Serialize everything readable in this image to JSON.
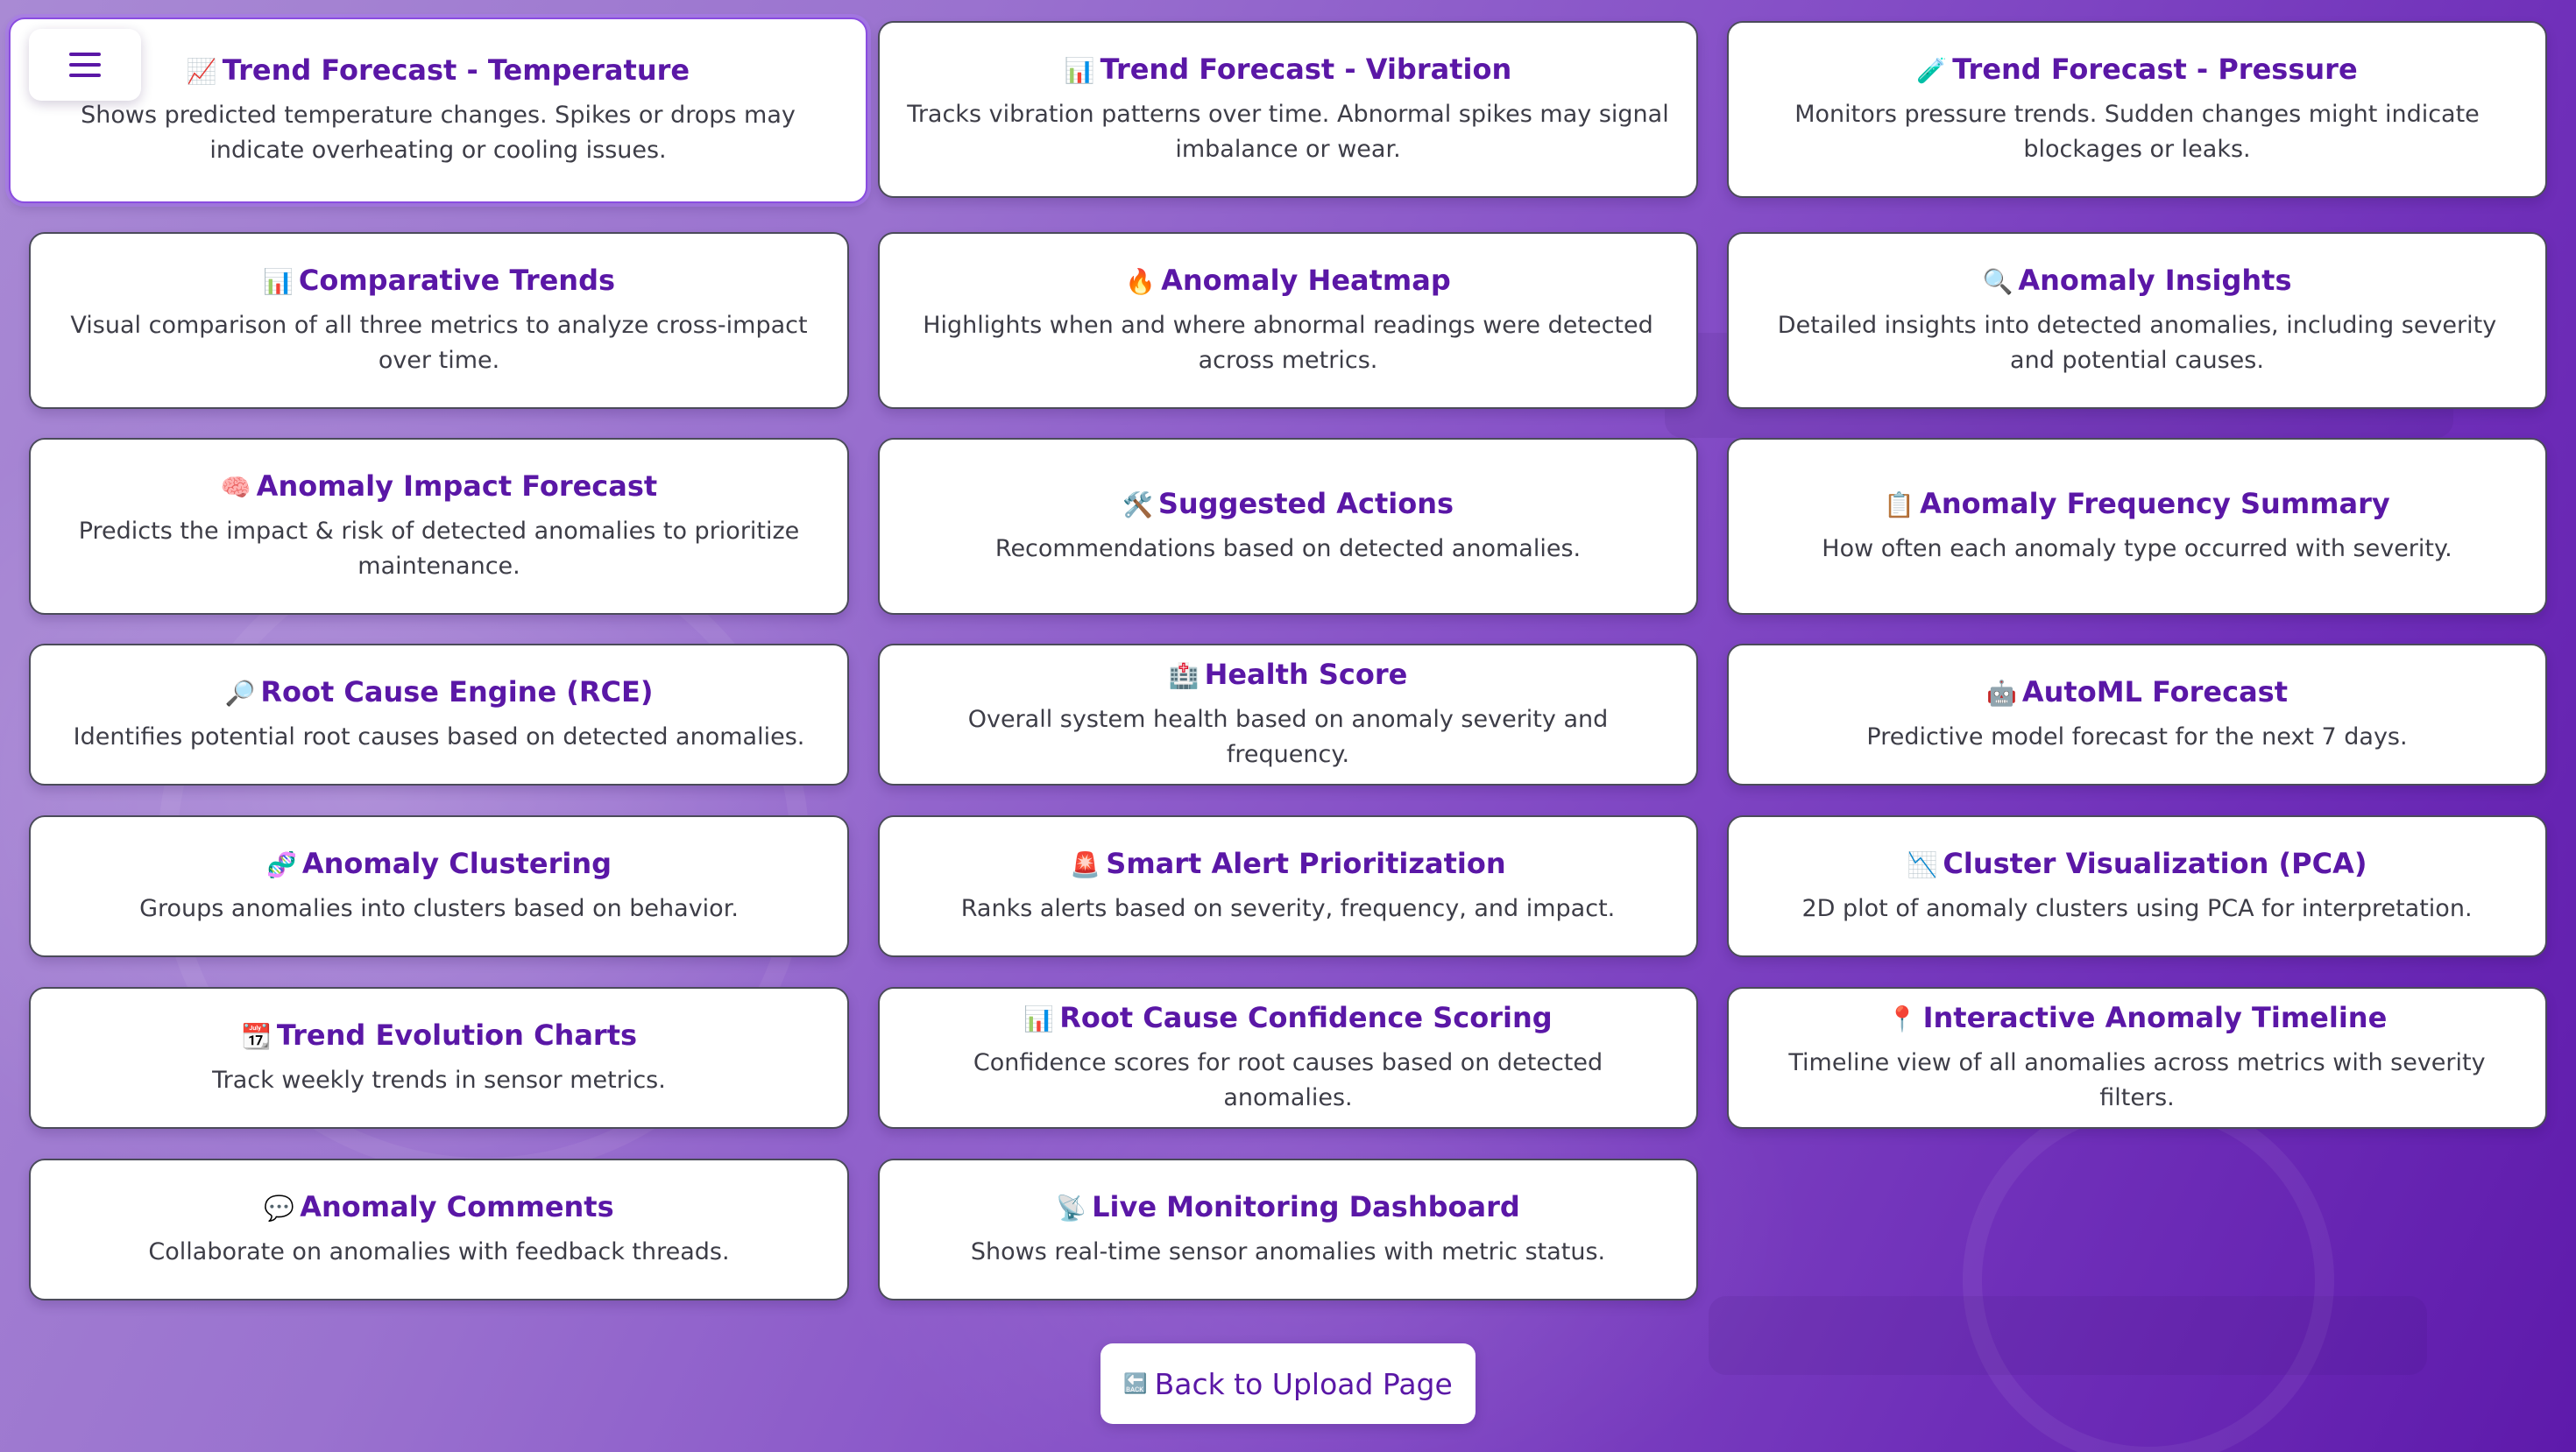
{
  "menu": {
    "icon": "hamburger-menu-icon"
  },
  "cards": [
    {
      "emoji": "📈",
      "icon": "chart-increasing-icon",
      "title": "Trend Forecast - Temperature",
      "desc": "Shows predicted temperature changes. Spikes or drops may indicate overheating or cooling issues."
    },
    {
      "emoji": "📊",
      "icon": "bar-chart-icon",
      "title": "Trend Forecast - Vibration",
      "desc": "Tracks vibration patterns over time. Abnormal spikes may signal imbalance or wear."
    },
    {
      "emoji": "🧪",
      "icon": "test-tube-icon",
      "title": "Trend Forecast - Pressure",
      "desc": "Monitors pressure trends. Sudden changes might indicate blockages or leaks."
    },
    {
      "emoji": "📊",
      "icon": "bar-chart-icon",
      "title": "Comparative Trends",
      "desc": "Visual comparison of all three metrics to analyze cross-impact over time."
    },
    {
      "emoji": "🔥",
      "icon": "fire-icon",
      "title": "Anomaly Heatmap",
      "desc": "Highlights when and where abnormal readings were detected across metrics."
    },
    {
      "emoji": "🔍",
      "icon": "magnifier-icon",
      "title": "Anomaly Insights",
      "desc": "Detailed insights into detected anomalies, including severity and potential causes."
    },
    {
      "emoji": "🧠",
      "icon": "brain-icon",
      "title": "Anomaly Impact Forecast",
      "desc": "Predicts the impact & risk of detected anomalies to prioritize maintenance."
    },
    {
      "emoji": "🛠️",
      "icon": "tools-icon",
      "title": "Suggested Actions",
      "desc": "Recommendations based on detected anomalies."
    },
    {
      "emoji": "📋",
      "icon": "clipboard-icon",
      "title": "Anomaly Frequency Summary",
      "desc": "How often each anomaly type occurred with severity."
    },
    {
      "emoji": "🔎",
      "icon": "magnifier-right-icon",
      "title": "Root Cause Engine (RCE)",
      "desc": "Identifies potential root causes based on detected anomalies."
    },
    {
      "emoji": "🏥",
      "icon": "hospital-icon",
      "title": "Health Score",
      "desc": "Overall system health based on anomaly severity and frequency."
    },
    {
      "emoji": "🤖",
      "icon": "robot-icon",
      "title": "AutoML Forecast",
      "desc": "Predictive model forecast for the next 7 days."
    },
    {
      "emoji": "🧬",
      "icon": "dna-icon",
      "title": "Anomaly Clustering",
      "desc": "Groups anomalies into clusters based on behavior."
    },
    {
      "emoji": "🚨",
      "icon": "siren-icon",
      "title": "Smart Alert Prioritization",
      "desc": "Ranks alerts based on severity, frequency, and impact."
    },
    {
      "emoji": "📉",
      "icon": "chart-decreasing-icon",
      "title": "Cluster Visualization (PCA)",
      "desc": "2D plot of anomaly clusters using PCA for interpretation."
    },
    {
      "emoji": "📆",
      "icon": "calendar-icon",
      "title": "Trend Evolution Charts",
      "desc": "Track weekly trends in sensor metrics."
    },
    {
      "emoji": "📊",
      "icon": "bar-chart-icon",
      "title": "Root Cause Confidence Scoring",
      "desc": "Confidence scores for root causes based on detected anomalies."
    },
    {
      "emoji": "📍",
      "icon": "pin-icon",
      "title": "Interactive Anomaly Timeline",
      "desc": "Timeline view of all anomalies across metrics with severity filters."
    },
    {
      "emoji": "💬",
      "icon": "speech-bubble-icon",
      "title": "Anomaly Comments",
      "desc": "Collaborate on anomalies with feedback threads."
    },
    {
      "emoji": "📡",
      "icon": "satellite-dish-icon",
      "title": "Live Monitoring Dashboard",
      "desc": "Shows real-time sensor anomalies with metric status."
    }
  ],
  "back": {
    "emoji": "🔙",
    "icon": "back-arrow-icon",
    "label": "Back to Upload Page"
  }
}
